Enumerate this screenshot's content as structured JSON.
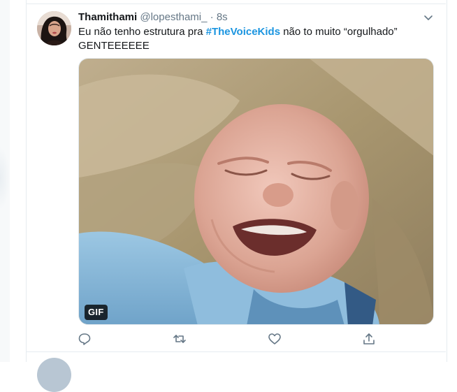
{
  "tweet": {
    "display_name": "Thamithami",
    "handle": "@lopesthami_",
    "separator": "·",
    "time": "8s",
    "text_before": "Eu não tenho estrutura pra ",
    "hashtag": "#TheVoiceKids",
    "text_after": " não to muito “orgulhado” GENTEEEEEE",
    "media_badge": "GIF",
    "avatar_icon": "user-avatar-photo",
    "more_icon": "chevron-down-icon"
  },
  "actions": [
    {
      "name": "reply",
      "icon": "reply-icon"
    },
    {
      "name": "retweet",
      "icon": "retweet-icon"
    },
    {
      "name": "like",
      "icon": "heart-icon"
    },
    {
      "name": "share",
      "icon": "share-icon"
    }
  ],
  "colors": {
    "link": "#1b95e0",
    "secondary_text": "#657786",
    "border": "#e6ecf0"
  }
}
